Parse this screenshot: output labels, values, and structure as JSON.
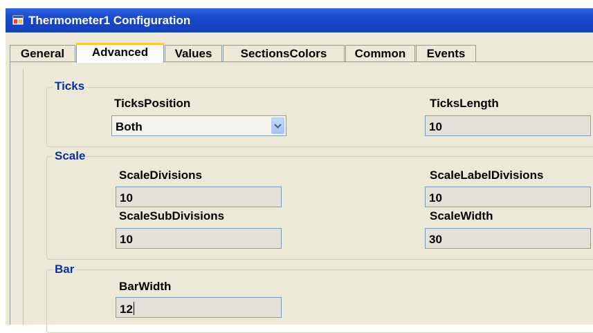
{
  "window": {
    "title": "Thermometer1 Configuration",
    "icon": "app-window-icon"
  },
  "tabs": [
    {
      "label": "General",
      "active": false
    },
    {
      "label": "Advanced",
      "active": true
    },
    {
      "label": "Values",
      "active": false
    },
    {
      "label": "SectionsColors",
      "active": false
    },
    {
      "label": "Common",
      "active": false
    },
    {
      "label": "Events",
      "active": false
    }
  ],
  "groups": {
    "ticks": {
      "legend": "Ticks",
      "ticks_position": {
        "label": "TicksPosition",
        "value": "Both"
      },
      "ticks_length": {
        "label": "TicksLength",
        "value": "10"
      }
    },
    "scale": {
      "legend": "Scale",
      "scale_divisions": {
        "label": "ScaleDivisions",
        "value": "10"
      },
      "scale_label_divisions": {
        "label": "ScaleLabelDivisions",
        "value": "10"
      },
      "scale_sub_divisions": {
        "label": "ScaleSubDivisions",
        "value": "10"
      },
      "scale_width": {
        "label": "ScaleWidth",
        "value": "30"
      }
    },
    "bar": {
      "legend": "Bar",
      "bar_width": {
        "label": "BarWidth",
        "value": "12"
      }
    }
  },
  "colors": {
    "titlebar": "#1847c9",
    "group_legend": "#0b2fa0",
    "face": "#ece9d8",
    "active_tab_accent": "#ffc83c"
  }
}
